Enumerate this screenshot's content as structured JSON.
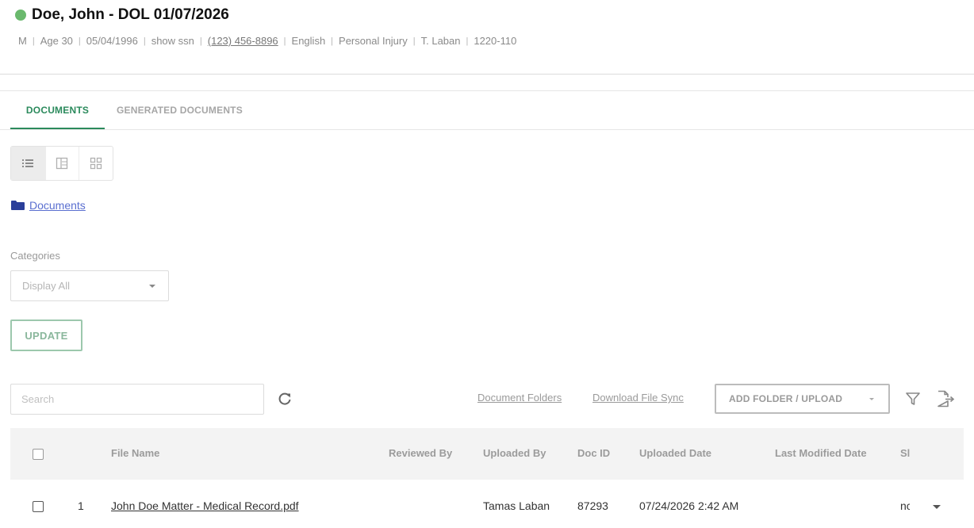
{
  "header": {
    "status_color": "#6ab96d",
    "title": "Doe, John - DOL 01/07/2026",
    "meta": {
      "sex": "M",
      "age": "Age 30",
      "dob": "05/04/1996",
      "ssn_link": "show ssn",
      "phone": "(123) 456-8896",
      "language": "English",
      "case_type": "Personal Injury",
      "attorney": "T. Laban",
      "case_number": "1220-110"
    }
  },
  "tabs": [
    {
      "label": "DOCUMENTS",
      "active": true
    },
    {
      "label": "GENERATED DOCUMENTS",
      "active": false
    }
  ],
  "view_toggle": {
    "options": [
      "list-view-icon",
      "split-view-icon",
      "grid-view-icon"
    ],
    "selected": "list-view-icon"
  },
  "breadcrumb": {
    "icon": "folder-icon",
    "label": "Documents"
  },
  "categories": {
    "label": "Categories",
    "selected": "Display All"
  },
  "update_label": "UPDATE",
  "toolbar": {
    "search_placeholder": "Search",
    "document_folders": "Document Folders",
    "download_file_sync": "Download File Sync",
    "add_folder_upload": "ADD FOLDER / UPLOAD"
  },
  "table": {
    "columns": [
      "File Name",
      "Reviewed By",
      "Uploaded By",
      "Doc ID",
      "Uploaded Date",
      "Last Modified Date",
      "Sl"
    ],
    "rows": [
      {
        "index": "1",
        "file_name": "John Doe Matter - Medical Record.pdf",
        "reviewed_by": "",
        "uploaded_by": "Tamas Laban",
        "doc_id": "87293",
        "uploaded_date": "07/24/2026 2:42 AM",
        "last_modified": "",
        "status": "nc"
      }
    ]
  },
  "colors": {
    "accent": "#2b8a5c",
    "link_blue": "#5a6fd0"
  }
}
